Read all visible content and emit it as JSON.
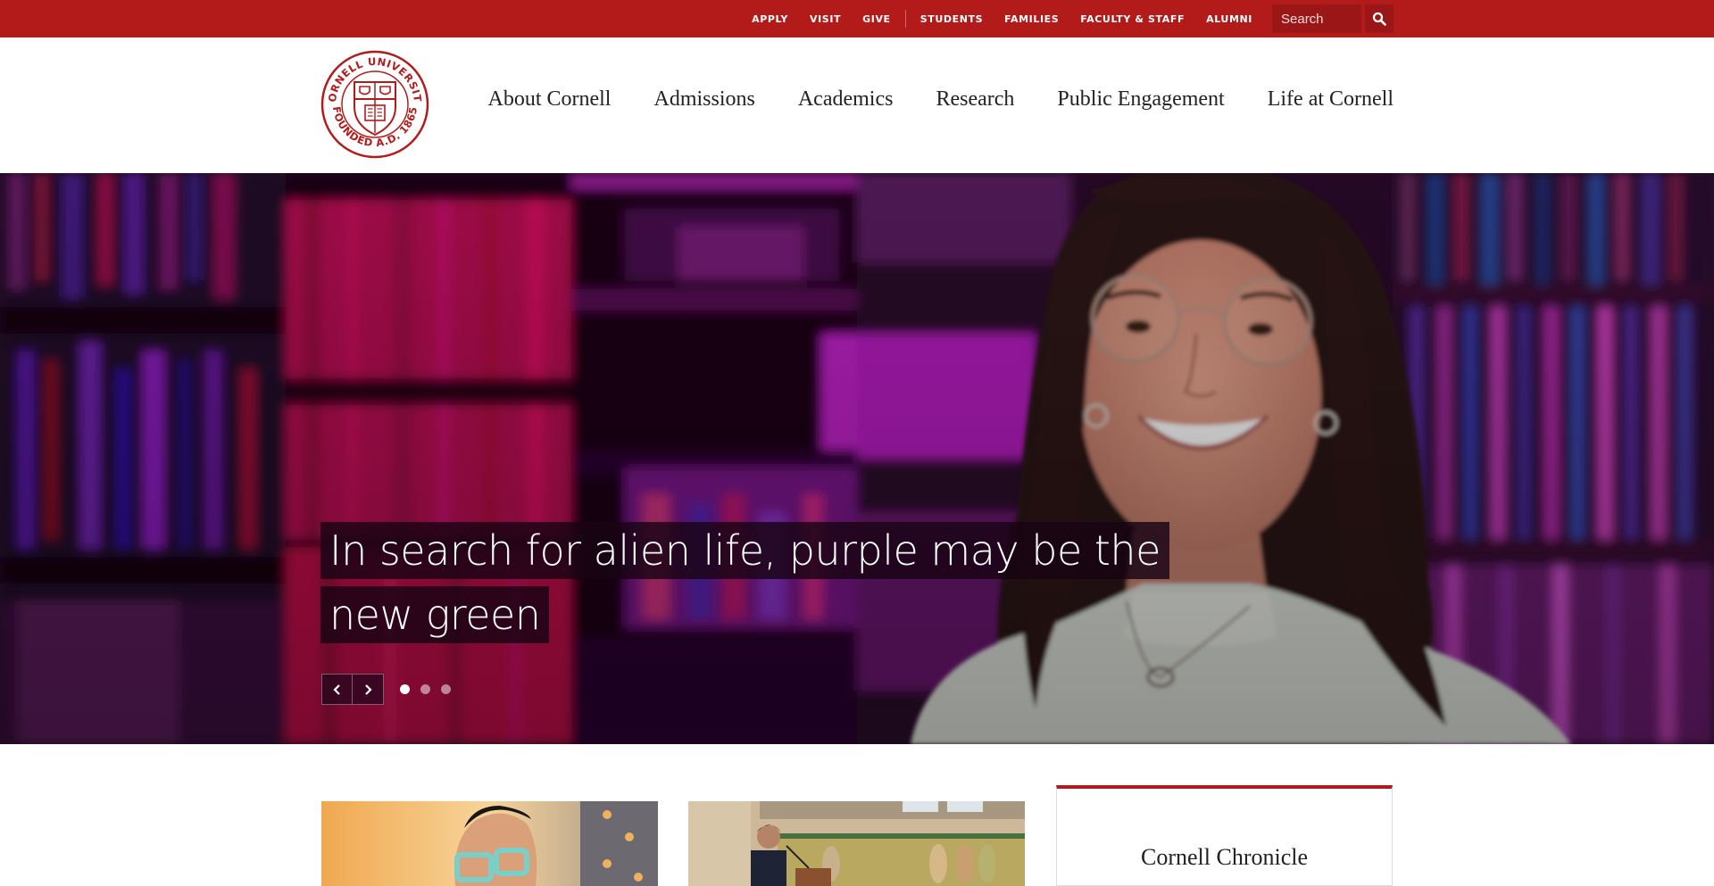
{
  "utility_nav": {
    "primary_links": [
      {
        "label": "APPLY"
      },
      {
        "label": "VISIT"
      },
      {
        "label": "GIVE"
      }
    ],
    "audience_links": [
      {
        "label": "STUDENTS"
      },
      {
        "label": "FAMILIES"
      },
      {
        "label": "FACULTY & STAFF"
      },
      {
        "label": "ALUMNI"
      }
    ],
    "search": {
      "placeholder": "Search",
      "button_icon": "search-icon"
    }
  },
  "header": {
    "logo": {
      "alt": "Cornell University",
      "ring_top_text": "CORNELL UNIVERSITY",
      "ring_bottom_text": "FOUNDED A.D. 1865"
    },
    "main_nav": [
      {
        "label": "About Cornell"
      },
      {
        "label": "Admissions"
      },
      {
        "label": "Academics"
      },
      {
        "label": "Research"
      },
      {
        "label": "Public Engagement"
      },
      {
        "label": "Life at Cornell"
      }
    ]
  },
  "hero": {
    "caption_lines": [
      "In search for alien life, purple may be the",
      "new green"
    ],
    "slide_count": 3,
    "active_slide": 1,
    "prev_icon": "chevron-left-icon",
    "next_icon": "chevron-right-icon"
  },
  "features": {
    "chronicle_title": "Cornell Chronicle"
  },
  "colors": {
    "brand_red": "#b31b1b",
    "search_bg": "#9b1717"
  }
}
